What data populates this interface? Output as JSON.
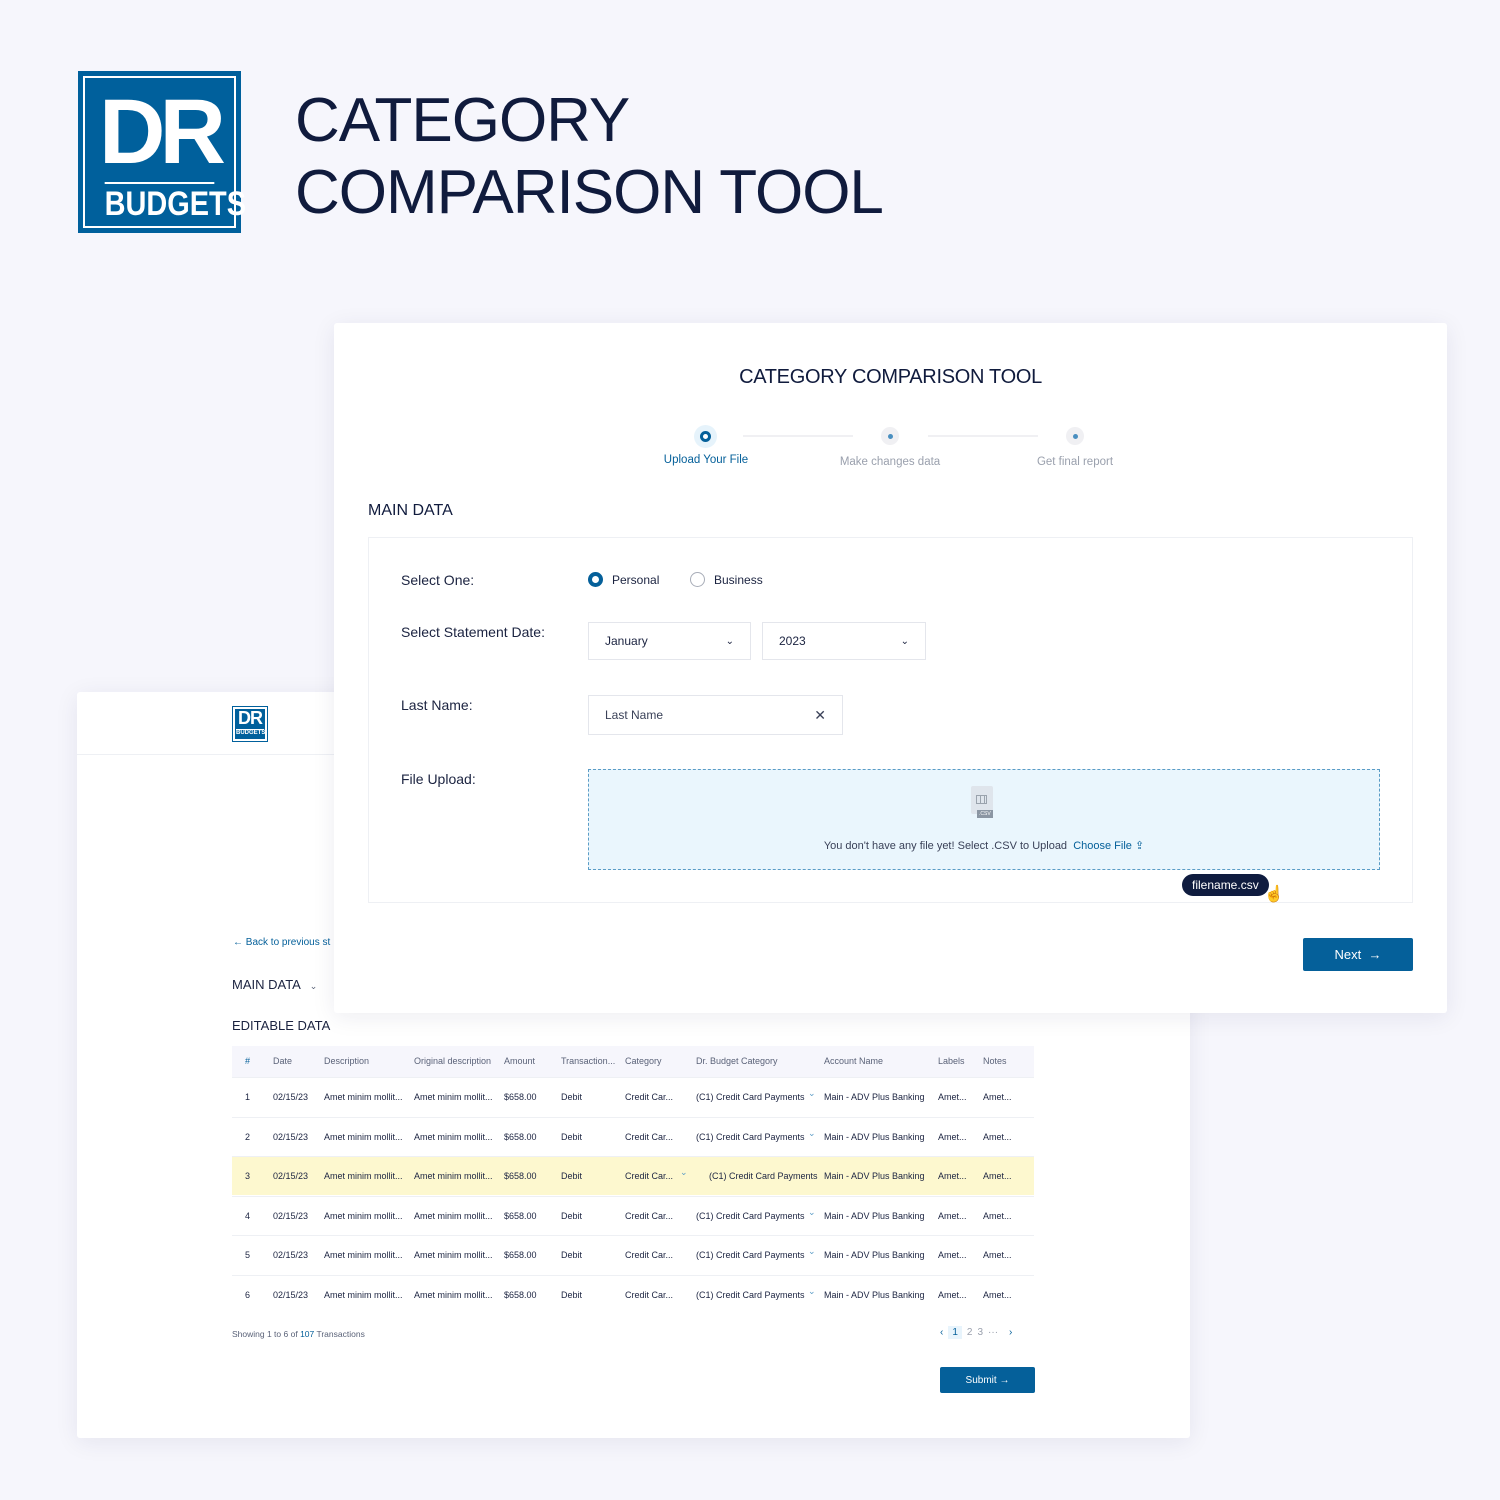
{
  "brand": {
    "logo_top": "DR",
    "logo_bottom": "BUDGETS",
    "color": "#00609c"
  },
  "hero": {
    "line1": "CATEGORY",
    "line2": "COMPARISON TOOL"
  },
  "back": {
    "back_link": "Back to previous st",
    "main_data": "MAIN DATA",
    "editable": "EDITABLE DATA",
    "columns": [
      "#",
      "Date",
      "Description",
      "Original description",
      "Amount",
      "Transaction...",
      "Category",
      "Dr. Budget Category",
      "Account Name",
      "Labels",
      "Notes"
    ],
    "rows": [
      [
        "1",
        "02/15/23",
        "Amet minim mollit...",
        "Amet minim mollit...",
        "$658.00",
        "Debit",
        "Credit Car...",
        "(C1) Credit Card Payments",
        "Main - ADV Plus Banking",
        "Amet...",
        "Amet..."
      ],
      [
        "2",
        "02/15/23",
        "Amet minim mollit...",
        "Amet minim mollit...",
        "$658.00",
        "Debit",
        "Credit Car...",
        "(C1) Credit Card Payments",
        "Main - ADV Plus Banking",
        "Amet...",
        "Amet..."
      ],
      [
        "3",
        "02/15/23",
        "Amet minim mollit...",
        "Amet minim mollit...",
        "$658.00",
        "Debit",
        "Credit Car...",
        "(C1) Credit Card Payments",
        "Main - ADV Plus Banking",
        "Amet...",
        "Amet..."
      ],
      [
        "4",
        "02/15/23",
        "Amet minim mollit...",
        "Amet minim mollit...",
        "$658.00",
        "Debit",
        "Credit Car...",
        "(C1) Credit Card Payments",
        "Main - ADV Plus Banking",
        "Amet...",
        "Amet..."
      ],
      [
        "5",
        "02/15/23",
        "Amet minim mollit...",
        "Amet minim mollit...",
        "$658.00",
        "Debit",
        "Credit Car...",
        "(C1) Credit Card Payments",
        "Main - ADV Plus Banking",
        "Amet...",
        "Amet..."
      ],
      [
        "6",
        "02/15/23",
        "Amet minim mollit...",
        "Amet minim mollit...",
        "$658.00",
        "Debit",
        "Credit Car...",
        "(C1) Credit Card Payments",
        "Main - ADV Plus Banking",
        "Amet...",
        "Amet..."
      ]
    ],
    "highlight_row": 3,
    "showing_pre": "Showing 1 to 6 of",
    "showing_total": "107",
    "showing_post": "Transactions",
    "pages": [
      "1",
      "2",
      "3",
      "···"
    ],
    "submit": "Submit"
  },
  "front": {
    "title": "CATEGORY COMPARISON TOOL",
    "steps": [
      "Upload Your File",
      "Make changes data",
      "Get final report"
    ],
    "active_step": 1,
    "section": "MAIN DATA",
    "select_one": "Select One:",
    "personal": "Personal",
    "business": "Business",
    "selected": "Personal",
    "date_label": "Select Statement Date:",
    "month": "January",
    "year": "2023",
    "last_name_label": "Last Name:",
    "last_name_placeholder": "Last Name",
    "file_label": "File Upload:",
    "csv_tag": ".CSV",
    "upload_text": "You don't have any file yet! Select .CSV to Upload",
    "choose": "Choose File",
    "tooltip": "filename.csv",
    "next": "Next"
  }
}
